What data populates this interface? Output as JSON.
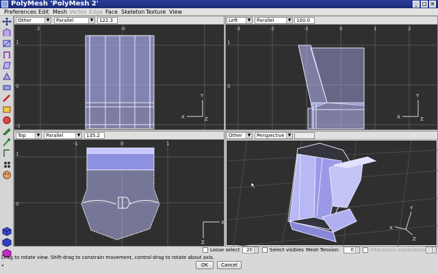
{
  "window": {
    "title": "PolyMesh 'PolyMesh 2'"
  },
  "menu": [
    "Preferences",
    "Edit",
    "Mesh",
    "Vertex",
    "Edge",
    "Face",
    "Skeleton",
    "Texture",
    "View"
  ],
  "menu_disabled": [
    "Vertex",
    "Edge"
  ],
  "tools": [
    "move-tool-icon",
    "bevel-tool-icon",
    "scale-tool-icon",
    "rotate-tool-icon",
    "skew-tool-icon",
    "taper-tool-icon",
    "thicken-tool-icon",
    "pick-tool-icon",
    "eraser-tool-icon",
    "color-tool-icon",
    "pencil-tool-icon",
    "brush-tool-icon",
    "spiral-tool-icon",
    "camera-move-icon",
    "camera-rotate-icon",
    "zoom-tool-icon"
  ],
  "viewports": {
    "top_left": {
      "view": "Other",
      "projection": "Parallel",
      "scale": "122.3",
      "x_ticks": [
        "2",
        "-0"
      ],
      "y_ticks": [
        "1",
        "0",
        "-1"
      ],
      "axis_labels": [
        "Y",
        "X",
        "Z"
      ]
    },
    "top_right": {
      "view": "Left",
      "projection": "Parallel",
      "scale": "100.0",
      "x_ticks": [
        "-3",
        "-2",
        "-1",
        "0",
        "1",
        "2"
      ],
      "y_ticks": [
        "1",
        "0"
      ],
      "axis_labels": [
        "Y",
        "X",
        "Z"
      ]
    },
    "bottom_left": {
      "view": "Top",
      "projection": "Parallel",
      "scale": "135.2",
      "x_ticks": [
        "-1",
        "0",
        "1"
      ],
      "y_ticks": [
        "1",
        "0"
      ],
      "axis_labels": [
        "X",
        "Z"
      ]
    },
    "bottom_right": {
      "view": "Other",
      "projection": "Perspective",
      "scale": "",
      "axis_labels": [
        "Y",
        "X",
        "Z"
      ]
    }
  },
  "bottom_options": {
    "loose_select_label": "Loose select",
    "loose_select_value": "20",
    "select_visibles_label": "Select visibles",
    "mesh_tension_label": "Mesh Tension:",
    "mesh_tension_value": "0",
    "interactive_subdivisions_label": "Interactive subdivisions",
    "interactive_subdivisions_value": "1"
  },
  "status": "Drag to rotate view.  Shift-drag to constrain movement, control-drag to rotate about axis.",
  "buttons": {
    "ok": "OK",
    "cancel": "Cancel"
  }
}
